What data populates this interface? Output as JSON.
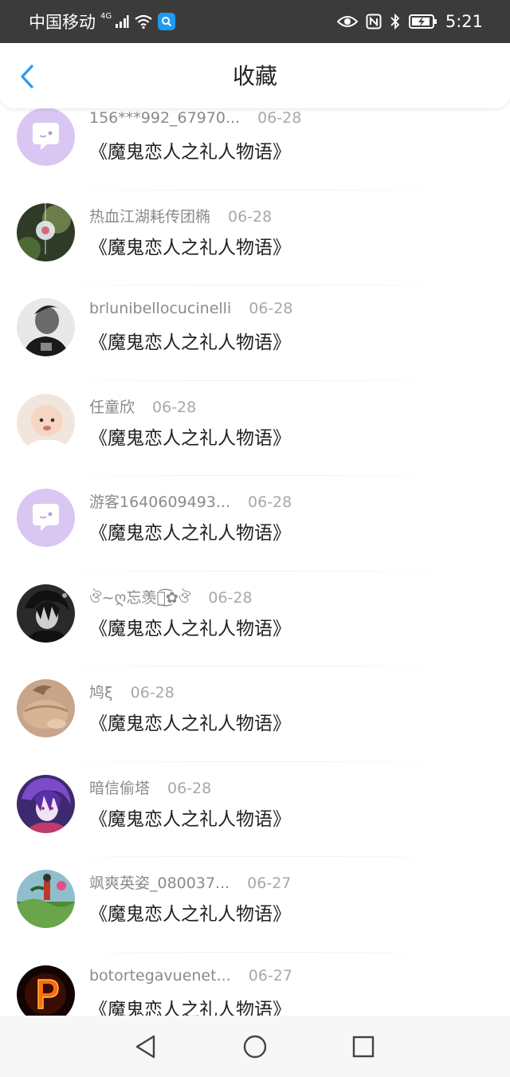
{
  "status_bar": {
    "carrier": "中国移动",
    "network": "4G",
    "time": "5:21"
  },
  "header": {
    "title": "收藏",
    "back_icon": "chevron-left-icon",
    "accent_color": "#2b9af3"
  },
  "items": [
    {
      "user": "156***992_67970...",
      "date": "06-28",
      "title": "《魔鬼恋人之礼人物语》",
      "avatar": "chat-bubble"
    },
    {
      "user": "热血江湖耗传团椭",
      "date": "06-28",
      "title": "《魔鬼恋人之礼人物语》",
      "avatar": "wind-chime-photo"
    },
    {
      "user": "brlunibellocucinelli",
      "date": "06-28",
      "title": "《魔鬼恋人之礼人物语》",
      "avatar": "man-portrait-bw"
    },
    {
      "user": "任童欣",
      "date": "06-28",
      "title": "《魔鬼恋人之礼人物语》",
      "avatar": "baby-photo"
    },
    {
      "user": "游客1640609493...",
      "date": "06-28",
      "title": "《魔鬼恋人之礼人物语》",
      "avatar": "chat-bubble"
    },
    {
      "user": "ঔ~ღ忘羡ⓑ͜͡✿ঔ",
      "date": "06-28",
      "title": "《魔鬼恋人之礼人物语》",
      "avatar": "anime-dark"
    },
    {
      "user": "鸠ξ",
      "date": "06-28",
      "title": "《魔鬼恋人之礼人物语》",
      "avatar": "cat-photo"
    },
    {
      "user": "暗信偷塔",
      "date": "06-28",
      "title": "《魔鬼恋人之礼人物语》",
      "avatar": "anime-purple"
    },
    {
      "user": "飒爽英姿_080037...",
      "date": "06-27",
      "title": "《魔鬼恋人之礼人物语》",
      "avatar": "landscape-figure"
    },
    {
      "user": "botortegavuenet...",
      "date": "06-27",
      "title": "《魔鬼恋人之礼人物语》",
      "avatar": "fire-letter-p"
    }
  ],
  "nav": {
    "back": "triangle-back-icon",
    "home": "circle-home-icon",
    "recent": "square-recent-icon"
  }
}
